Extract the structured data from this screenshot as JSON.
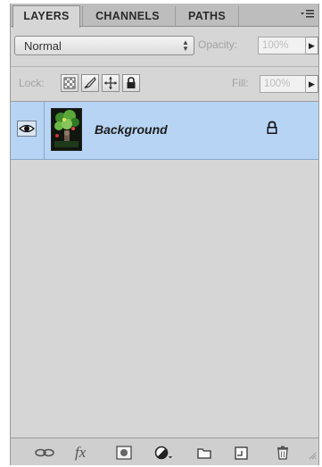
{
  "tabs": [
    {
      "label": "LAYERS",
      "active": true
    },
    {
      "label": "CHANNELS",
      "active": false
    },
    {
      "label": "PATHS",
      "active": false
    }
  ],
  "panel_menu_icon": "panel-menu-icon",
  "blend_mode": {
    "value": "Normal"
  },
  "opacity": {
    "label": "Opacity:",
    "value": "100%"
  },
  "lock": {
    "label": "Lock:",
    "buttons": [
      "lock-transparent-pixels-icon",
      "lock-image-pixels-icon",
      "lock-position-icon",
      "lock-all-icon"
    ]
  },
  "fill": {
    "label": "Fill:",
    "value": "100%"
  },
  "layers": [
    {
      "name": "Background",
      "visible": true,
      "locked": true,
      "selected": true
    }
  ],
  "toolbar": {
    "buttons": [
      "link-layers-icon",
      "fx",
      "add-mask-icon",
      "adjustment-layer-icon",
      "new-group-icon",
      "new-layer-icon",
      "delete-layer-icon"
    ]
  },
  "colors": {
    "panel_bg": "#d6d6d6",
    "selected_row": "#b7d4f4",
    "tab_bar": "#bdbdbd"
  }
}
